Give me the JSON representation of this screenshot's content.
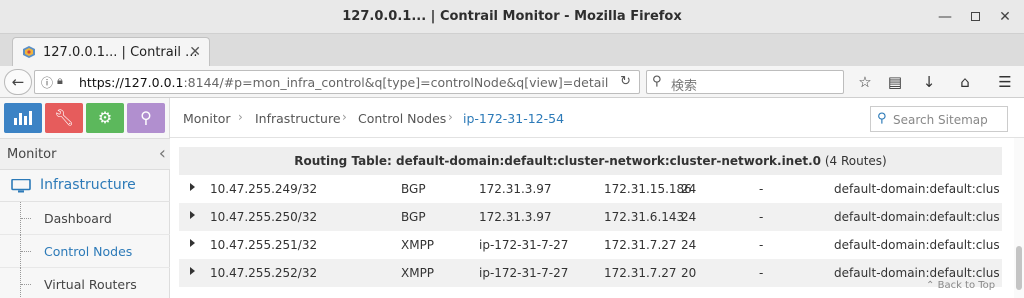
{
  "window": {
    "title": "127.0.0.1... | Contrail Monitor - Mozilla Firefox",
    "controls": [
      "minimize-icon",
      "maximize-icon",
      "close-icon"
    ]
  },
  "browser": {
    "tab_label": "127.0.0.1... | Contrail ...",
    "url_host": "https://127.0.0.1",
    "url_rest": ":8144/#p=mon_infra_control&q[type]=controlNode&q[view]=detail",
    "search_placeholder": "検索"
  },
  "sidebar": {
    "menu_buttons": [
      {
        "icon": "bar-chart-icon",
        "color": "#3c83c5"
      },
      {
        "icon": "wrench-icon",
        "color": "#e65c5c"
      },
      {
        "icon": "gear-icon",
        "color": "#5cb85c"
      },
      {
        "icon": "search-icon",
        "color": "#b18fcf"
      }
    ],
    "section_label": "Monitor",
    "infra_label": "Infrastructure",
    "items": [
      {
        "label": "Dashboard"
      },
      {
        "label": "Control Nodes"
      },
      {
        "label": "Virtual Routers"
      }
    ]
  },
  "breadcrumb": {
    "items": [
      "Monitor",
      "Infrastructure",
      "Control Nodes",
      "ip-172-31-12-54"
    ]
  },
  "sitemap": {
    "placeholder": "Search Sitemap"
  },
  "routing_table": {
    "title": "Routing Table: default-domain:default:cluster-network:cluster-network.inet.0",
    "count": "(4 Routes)",
    "rows": [
      {
        "prefix": "10.47.255.249/32",
        "protocol": "BGP",
        "source": "172.31.3.97",
        "next_hop": "172.31.15.186",
        "label": "24",
        "security": "-",
        "vn": "default-domain:default:clust..."
      },
      {
        "prefix": "10.47.255.250/32",
        "protocol": "BGP",
        "source": "172.31.3.97",
        "next_hop": "172.31.6.143",
        "label": "24",
        "security": "-",
        "vn": "default-domain:default:clust..."
      },
      {
        "prefix": "10.47.255.251/32",
        "protocol": "XMPP",
        "source": "ip-172-31-7-27",
        "next_hop": "172.31.7.27",
        "label": "24",
        "security": "-",
        "vn": "default-domain:default:clust..."
      },
      {
        "prefix": "10.47.255.252/32",
        "protocol": "XMPP",
        "source": "ip-172-31-7-27",
        "next_hop": "172.31.7.27",
        "label": "20",
        "security": "-",
        "vn": "default-domain:default:clust..."
      }
    ]
  },
  "back_to_top": "Back to Top"
}
